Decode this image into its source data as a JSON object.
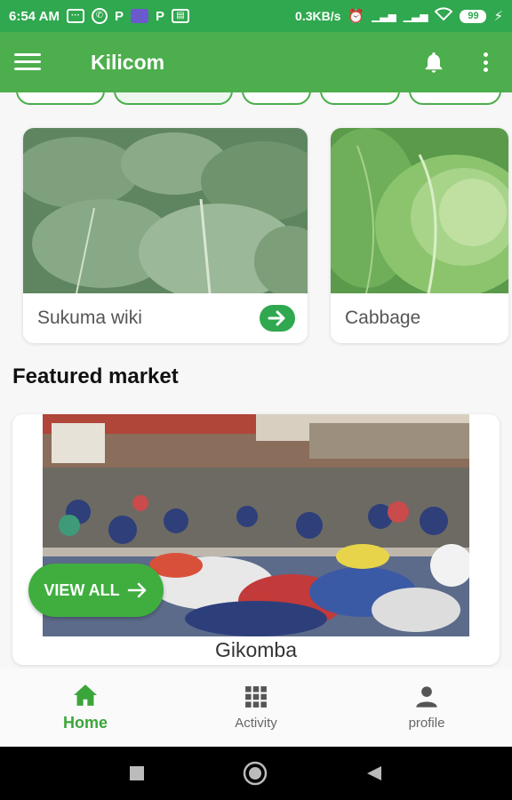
{
  "status_bar": {
    "time": "6:54 AM",
    "network_speed": "0.3KB/s",
    "battery": "99"
  },
  "app_bar": {
    "title": "Kilicom",
    "icons": [
      "hamburger-menu-icon",
      "bell-icon",
      "more-vert-icon"
    ]
  },
  "vegetables": [
    {
      "name": "Sukuma wiki",
      "icon": "arrow-right-icon"
    },
    {
      "name": "Cabbage"
    }
  ],
  "featured": {
    "title": "Featured market",
    "view_all_label": "VIEW ALL",
    "market_name": "Gikomba"
  },
  "bottom_nav": [
    {
      "label": "Home",
      "icon": "home-icon",
      "active": true
    },
    {
      "label": "Activity",
      "icon": "grid-icon",
      "active": false
    },
    {
      "label": "profile",
      "icon": "person-icon",
      "active": false
    }
  ],
  "colors": {
    "primary": "#4cae4c",
    "status_bar": "#2fa84f",
    "accent": "#3aa63a"
  }
}
